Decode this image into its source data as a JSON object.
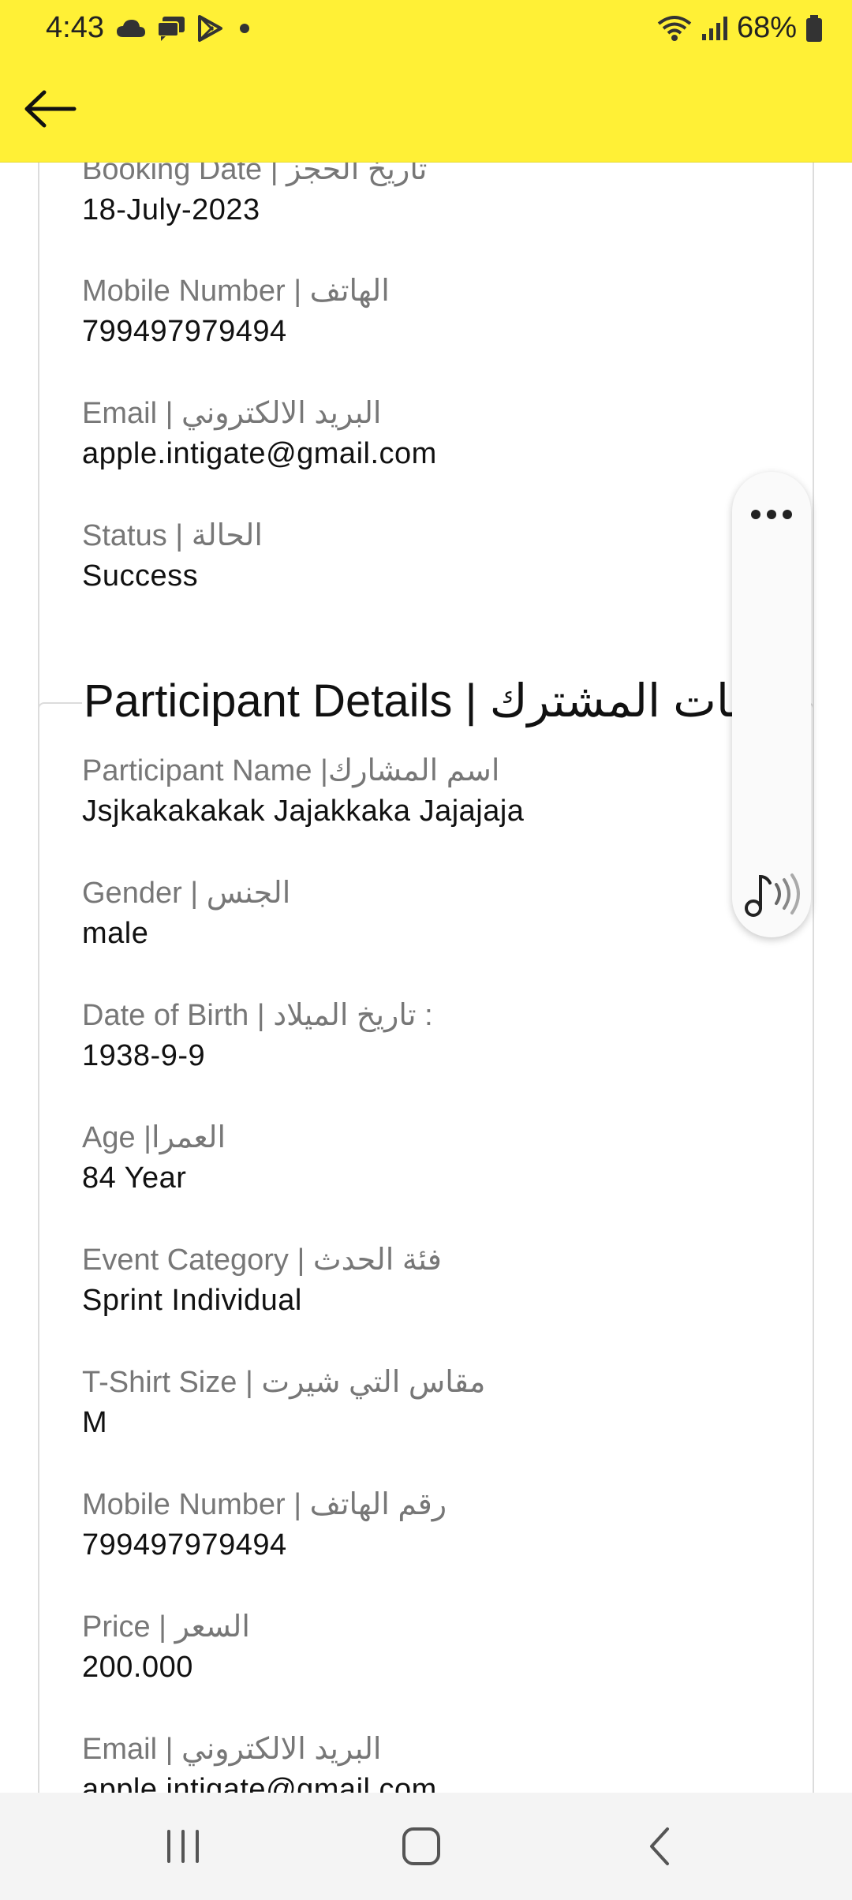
{
  "status_bar": {
    "time": "4:43",
    "battery": "68%",
    "icons_left": [
      "cloud-icon",
      "chat-icon",
      "play-store-icon",
      "dot-icon"
    ],
    "icons_right": [
      "wifi-icon",
      "signal-icon",
      "battery-icon"
    ]
  },
  "app_bar": {
    "back_icon": "arrow-left-icon",
    "color": "#fff036"
  },
  "booking": {
    "fields": [
      {
        "label": "Booking Date | تاريخ الحجز",
        "value": "18-July-2023"
      },
      {
        "label": "Mobile Number | الهاتف",
        "value": "799497979494"
      },
      {
        "label": "Email | البريد الالكتروني",
        "value": "apple.intigate@gmail.com"
      },
      {
        "label": "Status | الحالة",
        "value": "Success"
      }
    ]
  },
  "participant": {
    "title": "Participant Details | بيانات المشترك",
    "fields": [
      {
        "label": "Participant Name |اسم المشارك",
        "value": "Jsjkakakakak Jajakkaka Jajajaja"
      },
      {
        "label": "Gender | الجنس",
        "value": "male"
      },
      {
        "label": "Date of Birth | تاريخ الميلاد :",
        "value": "1938-9-9"
      },
      {
        "label": "Age |العمرا",
        "value": "84 Year"
      },
      {
        "label": "Event Category | فئة الحدث",
        "value": "Sprint Individual"
      },
      {
        "label": "T-Shirt Size | مقاس التي شيرت",
        "value": "M"
      },
      {
        "label": "Mobile Number | رقم الهاتف",
        "value": "799497979494"
      },
      {
        "label": "Price | السعر",
        "value": "200.000"
      },
      {
        "label": "Email | البريد الالكتروني",
        "value": "apple.intigate@gmail.com"
      }
    ]
  },
  "floating_panel": {
    "icons": [
      "more-dots-icon",
      "music-audio-icon"
    ]
  },
  "nav_bar": {
    "icons": [
      "recent-apps-icon",
      "home-icon",
      "back-nav-icon"
    ]
  }
}
